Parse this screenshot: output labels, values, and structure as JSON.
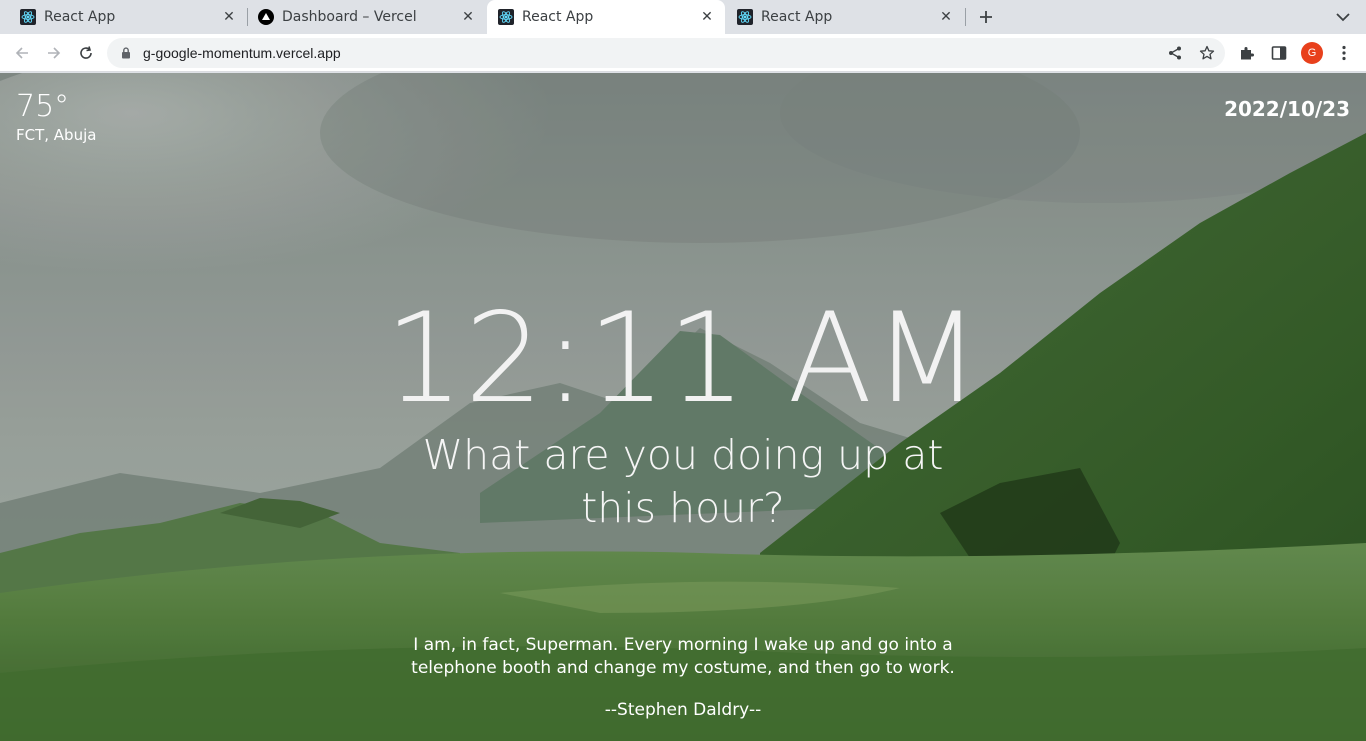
{
  "browser": {
    "tabs": [
      {
        "title": "React App",
        "favicon": "react-icon",
        "active": false
      },
      {
        "title": "Dashboard – Vercel",
        "favicon": "vercel-icon",
        "active": false
      },
      {
        "title": "React App",
        "favicon": "react-icon",
        "active": true
      },
      {
        "title": "React App",
        "favicon": "react-icon",
        "active": false
      }
    ],
    "url": "g-google-momentum.vercel.app",
    "profile_initial": "G",
    "profile_color": "#e8401c"
  },
  "page": {
    "weather": {
      "temperature": "75°",
      "location": "FCT, Abuja"
    },
    "date": "2022/10/23",
    "time": "12:11 AM",
    "greeting": "What are you doing up at this hour?",
    "quote": {
      "text": "I am, in fact, Superman. Every morning I wake up and go into a telephone booth and change my costume, and then go to work.",
      "author": "--Stephen Daldry--"
    }
  }
}
